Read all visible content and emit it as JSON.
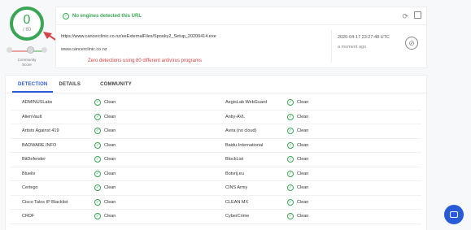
{
  "score": {
    "value": "0",
    "total": "/ 80"
  },
  "community": {
    "label": "Community\nScore",
    "value": "0"
  },
  "summary": {
    "status_text": "No engines detected this URL",
    "url": "https://www.cancerclinic.co.nz/eeExternalFiles/Spooky2_Setup_20200414.exe",
    "host": "www.cancerclinic.co.nz",
    "date": "2020-04-17 23:27:48 UTC",
    "ago": "a moment ago"
  },
  "annotation": "Zero detections using 80 different antivirus programs",
  "tabs": [
    "DETECTION",
    "DETAILS",
    "COMMUNITY"
  ],
  "rows": [
    {
      "a": "ADMINUSLabs",
      "ar": "Clean",
      "b": "AegisLab WebGuard",
      "br": "Clean"
    },
    {
      "a": "AlienVault",
      "ar": "Clean",
      "b": "Antiy-AVL",
      "br": "Clean"
    },
    {
      "a": "Artists Against 419",
      "ar": "Clean",
      "b": "Avira (no cloud)",
      "br": "Clean"
    },
    {
      "a": "BADWARE.INFO",
      "ar": "Clean",
      "b": "Baidu-International",
      "br": "Clean"
    },
    {
      "a": "BitDefender",
      "ar": "Clean",
      "b": "BlockList",
      "br": "Clean"
    },
    {
      "a": "Blueliv",
      "ar": "Clean",
      "b": "Botvrij.eu",
      "br": "Clean"
    },
    {
      "a": "Certego",
      "ar": "Clean",
      "b": "CINS Army",
      "br": "Clean"
    },
    {
      "a": "Cisco Talos IP Blacklist",
      "ar": "Clean",
      "b": "CLEAN MX",
      "br": "Clean"
    },
    {
      "a": "CRDF",
      "ar": "Clean",
      "b": "CyberCrime",
      "br": "Clean"
    }
  ],
  "colors": {
    "clean_green": "#3aa655",
    "accent_blue": "#2a5bd7",
    "annotation_red": "#d64545"
  }
}
